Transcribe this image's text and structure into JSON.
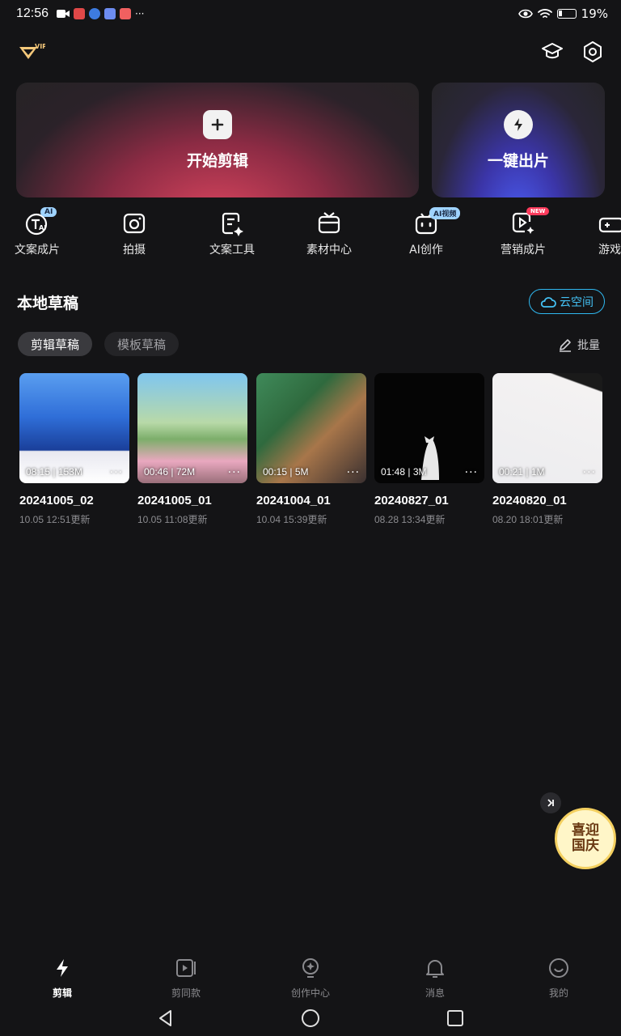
{
  "status_bar": {
    "time": "12:56",
    "more": "···",
    "battery": "19%"
  },
  "header": {
    "vip_badge": "VIP"
  },
  "cards": {
    "start_edit": {
      "label": "开始剪辑",
      "icon": "plus-icon"
    },
    "one_click": {
      "label": "一键出片",
      "icon": "lightning-icon"
    }
  },
  "tools": [
    {
      "label": "文案成片",
      "tag": "AI",
      "icon": "text-ai-icon"
    },
    {
      "label": "拍摄",
      "tag": "",
      "icon": "camera-icon"
    },
    {
      "label": "文案工具",
      "tag": "",
      "icon": "document-edit-icon"
    },
    {
      "label": "素材中心",
      "tag": "",
      "icon": "tv-icon"
    },
    {
      "label": "AI创作",
      "tag": "AI视频",
      "icon": "robot-icon"
    },
    {
      "label": "营销成片",
      "tag": "NEW",
      "icon": "video-sparkle-icon"
    },
    {
      "label": "游戏",
      "tag": "",
      "icon": "gamepad-icon"
    }
  ],
  "drafts": {
    "title": "本地草稿",
    "cloud_button": "云空间",
    "tabs": [
      "剪辑草稿",
      "模板草稿"
    ],
    "batch_label": "批量",
    "items": [
      {
        "name": "20241005_02",
        "updated": "10.05 12:51更新",
        "duration": "08:15",
        "size": "153M",
        "more": "···"
      },
      {
        "name": "20241005_01",
        "updated": "10.05 11:08更新",
        "duration": "00:46",
        "size": "72M",
        "more": "···"
      },
      {
        "name": "20241004_01",
        "updated": "10.04 15:39更新",
        "duration": "00:15",
        "size": "5M",
        "more": "···"
      },
      {
        "name": "20240827_01",
        "updated": "08.28 13:34更新",
        "duration": "01:48",
        "size": "3M",
        "more": "···"
      },
      {
        "name": "20240820_01",
        "updated": "08.20 18:01更新",
        "duration": "00:21",
        "size": "1M",
        "more": "···"
      }
    ]
  },
  "promo": {
    "line1": "喜迎",
    "line2": "国庆"
  },
  "bottom_nav": [
    {
      "label": "剪辑",
      "active": true
    },
    {
      "label": "剪同款",
      "active": false
    },
    {
      "label": "创作中心",
      "active": false
    },
    {
      "label": "消息",
      "active": false
    },
    {
      "label": "我的",
      "active": false
    }
  ],
  "colors": {
    "accent_cyan": "#2fb8f0",
    "background": "#141416"
  }
}
